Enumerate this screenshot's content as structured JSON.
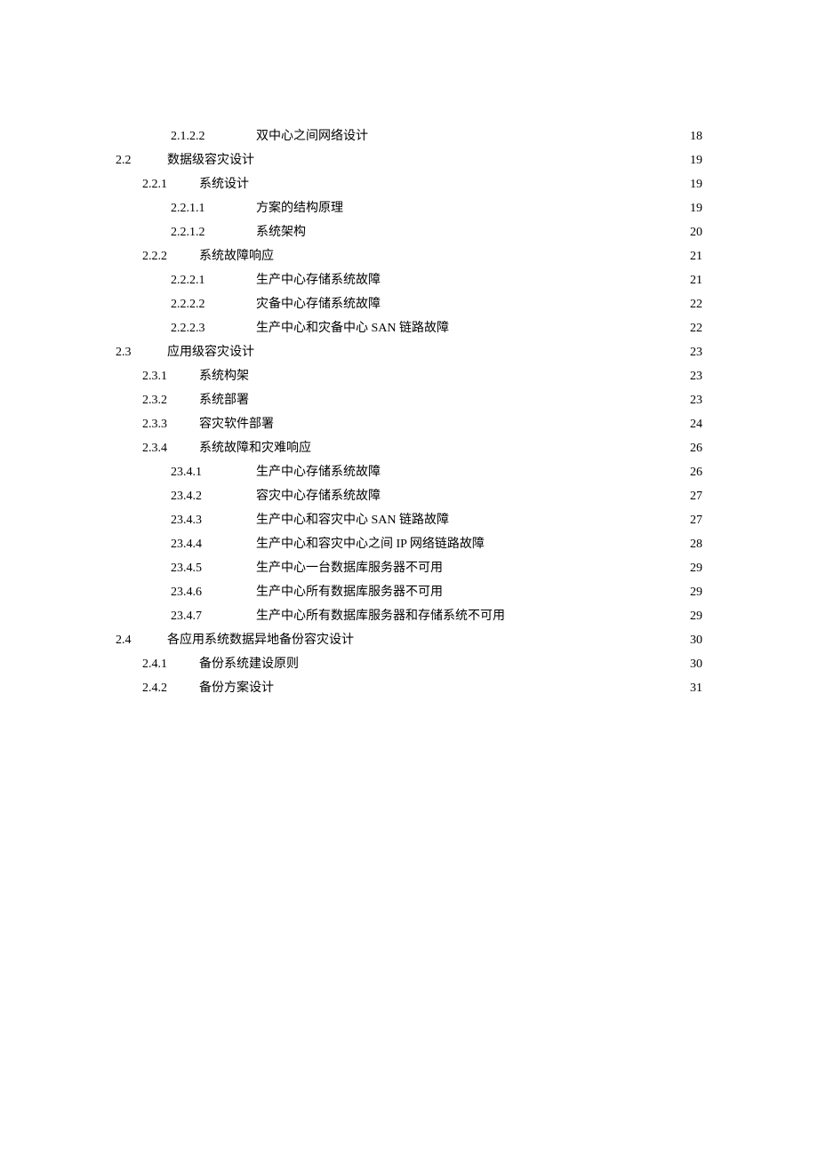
{
  "entries": [
    {
      "level": 3,
      "num": "2.1.2.2",
      "title": "双中心之间网络设计",
      "page": "18"
    },
    {
      "level": 1,
      "num": "2.2",
      "title": "数据级容灾设计",
      "page": "19"
    },
    {
      "level": 2,
      "num": "2.2.1",
      "title": "系统设计",
      "page": "19"
    },
    {
      "level": 3,
      "num": "2.2.1.1",
      "title": "方案的结构原理",
      "page": "19"
    },
    {
      "level": 3,
      "num": "2.2.1.2",
      "title": "系统架构",
      "page": "20"
    },
    {
      "level": 2,
      "num": "2.2.2",
      "title": "系统故障响应",
      "page": "21"
    },
    {
      "level": 3,
      "num": "2.2.2.1",
      "title": "生产中心存储系统故障",
      "page": "21"
    },
    {
      "level": 3,
      "num": "2.2.2.2",
      "title": "灾备中心存储系统故障",
      "page": "22"
    },
    {
      "level": 3,
      "num": "2.2.2.3",
      "title": "生产中心和灾备中心 SAN 链路故障",
      "page": "22"
    },
    {
      "level": 1,
      "num": "2.3",
      "title": "应用级容灾设计",
      "page": "23"
    },
    {
      "level": 2,
      "num": "2.3.1",
      "title": "系统构架",
      "page": "23"
    },
    {
      "level": 2,
      "num": "2.3.2",
      "title": "系统部署",
      "page": "23"
    },
    {
      "level": 2,
      "num": "2.3.3",
      "title": "容灾软件部署",
      "page": "24"
    },
    {
      "level": 2,
      "num": "2.3.4",
      "title": "系统故障和灾难响应",
      "page": "26"
    },
    {
      "level": 3,
      "num": "23.4.1",
      "title": "生产中心存储系统故障",
      "page": "26"
    },
    {
      "level": 3,
      "num": "23.4.2",
      "title": "容灾中心存储系统故障",
      "page": "27"
    },
    {
      "level": 3,
      "num": "23.4.3",
      "title": "生产中心和容灾中心 SAN 链路故障",
      "page": "27"
    },
    {
      "level": 3,
      "num": "23.4.4",
      "title": "生产中心和容灾中心之间 IP 网络链路故障",
      "page": "28"
    },
    {
      "level": 3,
      "num": "23.4.5",
      "title": "生产中心一台数据库服务器不可用",
      "page": "29"
    },
    {
      "level": 3,
      "num": "23.4.6",
      "title": "生产中心所有数据库服务器不可用",
      "page": "29"
    },
    {
      "level": 3,
      "num": "23.4.7",
      "title": "生产中心所有数据库服务器和存储系统不可用",
      "page": "29"
    },
    {
      "level": 1,
      "num": "2.4",
      "title": "各应用系统数据异地备份容灾设计",
      "page": "30"
    },
    {
      "level": 2,
      "num": "2.4.1",
      "title": "备份系统建设原则",
      "page": "30"
    },
    {
      "level": 2,
      "num": "2.4.2",
      "title": "备份方案设计",
      "page": "31"
    }
  ]
}
